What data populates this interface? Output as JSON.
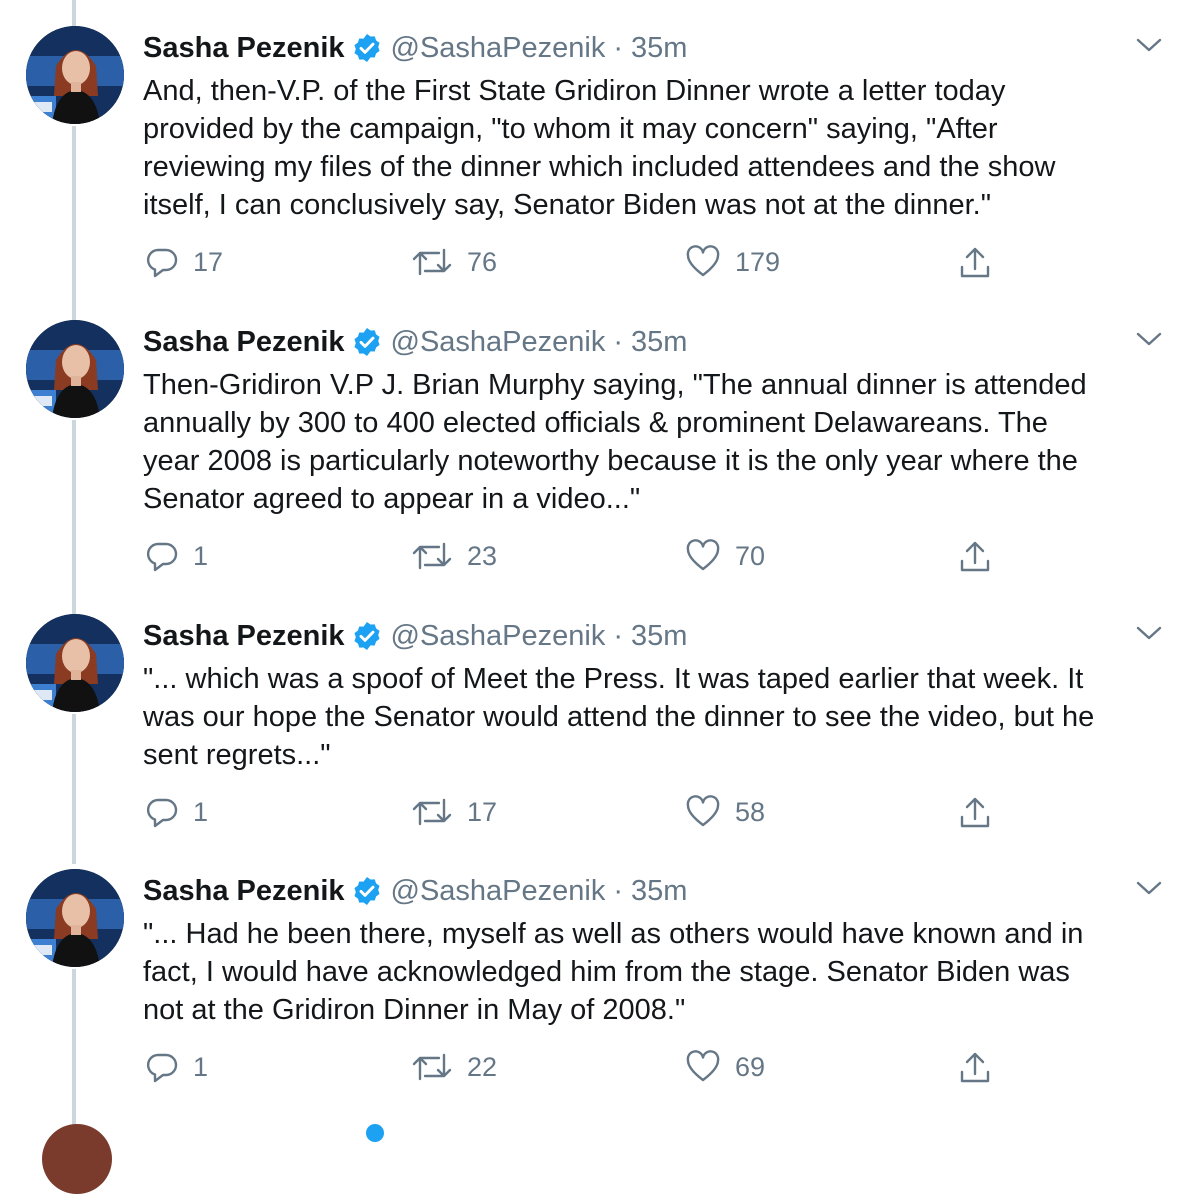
{
  "colors": {
    "verified": "#1da1f2",
    "muted": "#657786",
    "thread_line": "#ccd6dd"
  },
  "tweets": [
    {
      "name": "Sasha Pezenik",
      "handle": "@SashaPezenik",
      "separator": "·",
      "time": "35m",
      "text": "And, then-V.P. of the First State Gridiron Dinner wrote a letter today\nprovided by the campaign, \"to whom it may concern\" saying, \"After\nreviewing my files of the dinner which included attendees and the show\nitself, I can conclusively say, Senator Biden was not at the dinner.\"",
      "replies": "17",
      "retweets": "76",
      "likes": "179"
    },
    {
      "name": "Sasha Pezenik",
      "handle": "@SashaPezenik",
      "separator": "·",
      "time": "35m",
      "text": "Then-Gridiron V.P J. Brian Murphy saying, \"The annual dinner is attended\nannually by 300 to 400 elected officials & prominent Delawareans. The\nyear 2008 is particularly noteworthy because it is the only year where the\nSenator agreed to appear in a video...\"",
      "replies": "1",
      "retweets": "23",
      "likes": "70"
    },
    {
      "name": "Sasha Pezenik",
      "handle": "@SashaPezenik",
      "separator": "·",
      "time": "35m",
      "text": "\"... which was a spoof of Meet the Press. It was taped earlier that week. It\nwas our hope the Senator would attend the dinner to see the video, but he\nsent regrets...\"",
      "replies": "1",
      "retweets": "17",
      "likes": "58"
    },
    {
      "name": "Sasha Pezenik",
      "handle": "@SashaPezenik",
      "separator": "·",
      "time": "35m",
      "text": "\"... Had he been there, myself as well as others would have known and in\nfact, I would have acknowledged him from the stage. Senator Biden was\nnot at the Gridiron Dinner in May of 2008.\"",
      "replies": "1",
      "retweets": "22",
      "likes": "69"
    }
  ]
}
